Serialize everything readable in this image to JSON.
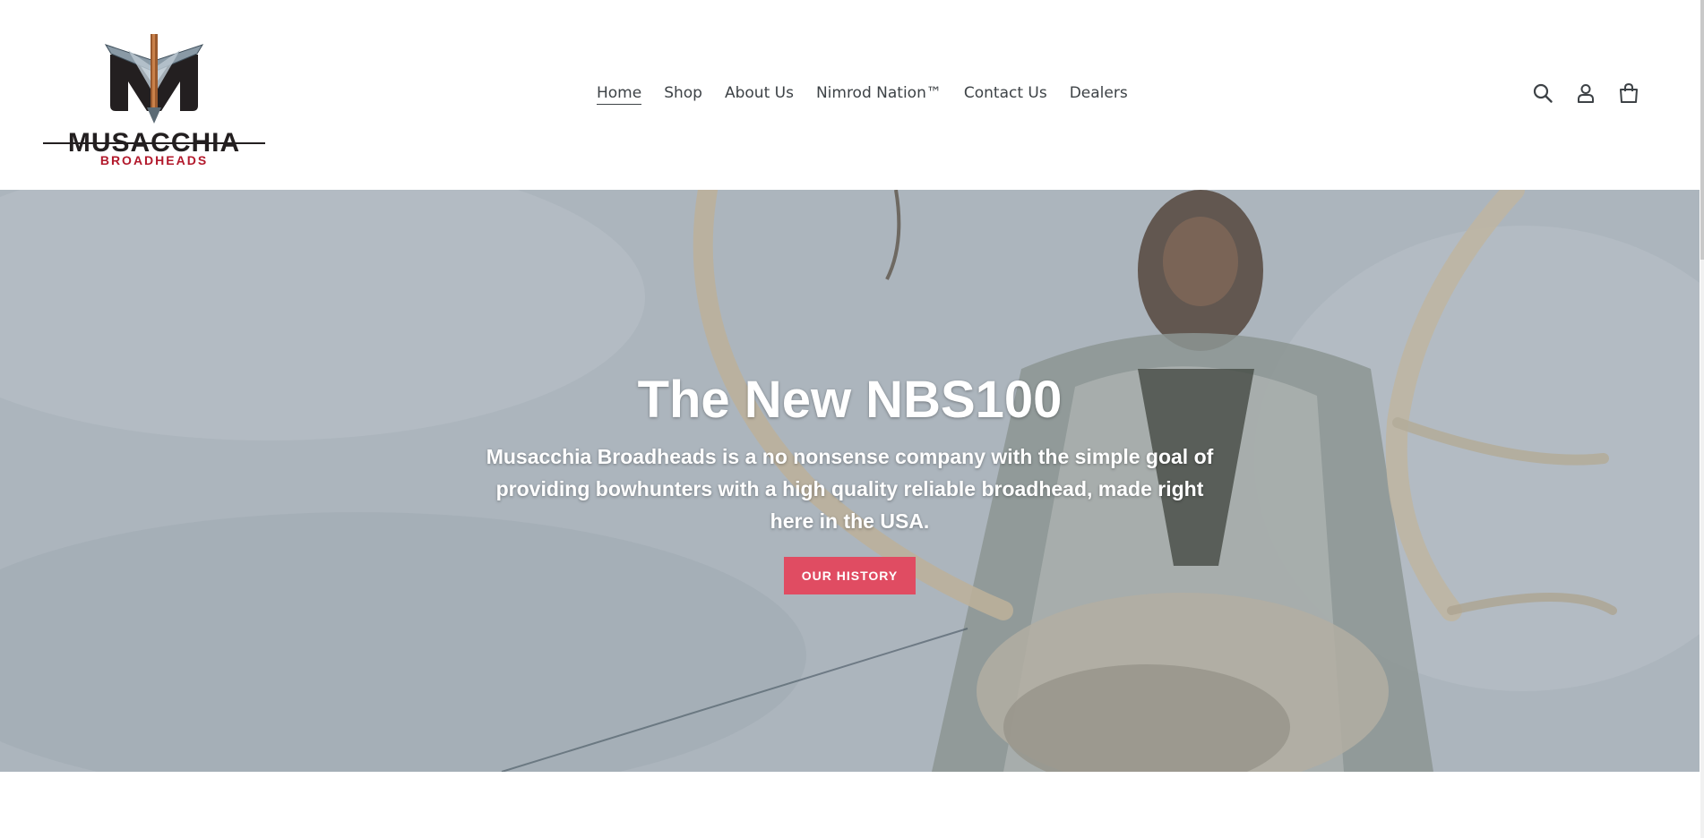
{
  "brand": {
    "name": "MUSACCHIA",
    "tagline": "BROADHEADS",
    "logo_icon": "broadhead-m-logo",
    "colors": {
      "dark": "#231f20",
      "red": "#b2182b"
    }
  },
  "nav": {
    "items": [
      {
        "label": "Home",
        "active": true
      },
      {
        "label": "Shop",
        "active": false
      },
      {
        "label": "About Us",
        "active": false
      },
      {
        "label": "Nimrod Nation™",
        "active": false
      },
      {
        "label": "Contact Us",
        "active": false
      },
      {
        "label": "Dealers",
        "active": false
      }
    ]
  },
  "header_icons": {
    "search": "search-icon",
    "account": "account-icon",
    "cart": "cart-icon"
  },
  "hero": {
    "title": "The New NBS100",
    "text": "Musacchia Broadheads is a no nonsense company with the simple goal of providing bowhunters with a high quality reliable broadhead, made right here in the USA.",
    "button_label": "OUR HISTORY",
    "button_color": "#e04c62"
  }
}
